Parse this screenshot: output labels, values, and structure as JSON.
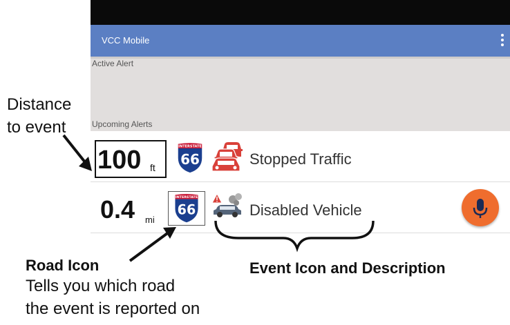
{
  "app": {
    "title": "VCC Mobile"
  },
  "sections": {
    "active_alert": "Active Alert",
    "upcoming_alerts": "Upcoming Alerts"
  },
  "alerts": [
    {
      "distance": "100",
      "unit": "ft",
      "road_top": "INTERSTATE",
      "road": "66",
      "event_icon": "stopped-traffic-icon",
      "event": "Stopped Traffic"
    },
    {
      "distance": "0.4",
      "unit": "mi",
      "road_top": "INTERSTATE",
      "road": "66",
      "event_icon": "disabled-vehicle-icon",
      "event": "Disabled Vehicle"
    }
  ],
  "annotations": {
    "distance_line1": "Distance",
    "distance_line2": "to event",
    "road_title": "Road Icon",
    "road_desc_line1": "Tells you which road",
    "road_desc_line2": "the event is reported on",
    "event_label": "Event Icon and Description"
  },
  "colors": {
    "appbar": "#5b7fc3",
    "statusbar": "#0a0a0a",
    "alerts_bg": "#e1dedd",
    "mic": "#ef6d2e",
    "shield_blue": "#1b3f8f",
    "shield_red": "#c8102e",
    "traffic_red": "#d9413a"
  }
}
